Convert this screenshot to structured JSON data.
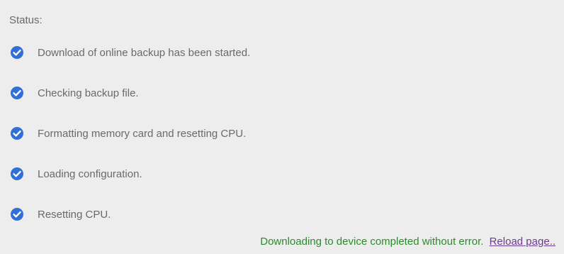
{
  "status": {
    "heading": "Status:",
    "steps": [
      {
        "label": "Download of online backup has been started.",
        "icon": "check-circle-icon"
      },
      {
        "label": "Checking backup file.",
        "icon": "check-circle-icon"
      },
      {
        "label": "Formatting memory card and resetting CPU.",
        "icon": "check-circle-icon"
      },
      {
        "label": "Loading configuration.",
        "icon": "check-circle-icon"
      },
      {
        "label": "Resetting CPU.",
        "icon": "check-circle-icon"
      }
    ]
  },
  "footer": {
    "completion_text": "Downloading to device completed without error.",
    "reload_link": "Reload page.."
  },
  "colors": {
    "background": "#ededed",
    "text": "#6a6a6a",
    "check_icon": "#2f6fd6",
    "success_text": "#2d8b2d",
    "link": "#6a3d8f"
  }
}
